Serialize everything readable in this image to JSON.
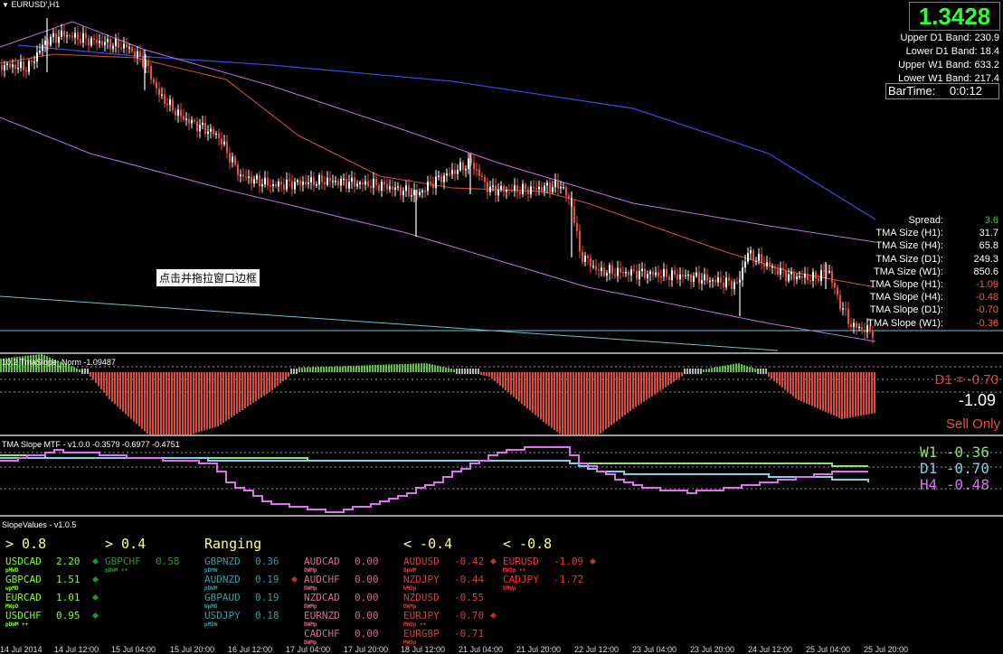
{
  "main": {
    "title": "EURUSD',H1",
    "price": "1.3428",
    "bands": [
      {
        "label": "Upper D1 Band:",
        "value": "230.9"
      },
      {
        "label": "Lower D1 Band:",
        "value": "18.4"
      },
      {
        "label": "Upper W1 Band:",
        "value": "633.2"
      },
      {
        "label": "Lower W1 Band:",
        "value": "217.4"
      }
    ],
    "bartime_label": "BarTime:",
    "bartime_value": "0:0:12",
    "info": [
      {
        "label": "Spread:",
        "value": "3.6",
        "color": "#32d232"
      },
      {
        "label": "TMA Size (H1):",
        "value": "31.7",
        "color": "#ffffff"
      },
      {
        "label": "TMA Size (H4):",
        "value": "65.8",
        "color": "#ffffff"
      },
      {
        "label": "TMA Size (D1):",
        "value": "249.3",
        "color": "#ffffff"
      },
      {
        "label": "TMA Size (W1):",
        "value": "850.6",
        "color": "#ffffff"
      },
      {
        "label": "TMA Slope (H1):",
        "value": "-1.09",
        "color": "#ff5a3c"
      },
      {
        "label": "TMA Slope (H4):",
        "value": "-0.48",
        "color": "#ff5a3c"
      },
      {
        "label": "TMA Slope (D1):",
        "value": "-0.70",
        "color": "#ff5a3c"
      },
      {
        "label": "TMA Slope (W1):",
        "value": "-0.36",
        "color": "#ff5a3c"
      }
    ],
    "tooltip": "点击并拖拉窗口边框"
  },
  "norm_panel": {
    "title": "10.2 TmaSlope_Norm -1.09487",
    "d1_text": "D1 = -0.70",
    "h1_value": "-1.09",
    "signal": "Sell Only"
  },
  "mtf_panel": {
    "title": "TMA Slope MTF - v1.0.0 -0.3579 -0.6977 -0.4751",
    "legend": [
      {
        "label": "W1 -0.36",
        "color": "#90e070"
      },
      {
        "label": "D1 -0.70",
        "color": "#80d0e8"
      },
      {
        "label": "H4 -0.48",
        "color": "#e070f0"
      }
    ]
  },
  "slope_panel": {
    "title": "SlopeValues - v1.0.5",
    "columns": [
      {
        "header": "> 0.8",
        "header_color": "#ffff80",
        "pairs": [
          {
            "name": "USDCAD",
            "value": "2.20",
            "sub": "pMWD",
            "color": "#80ff20",
            "dot": "#1a9a1a"
          },
          {
            "name": "GBPCAD",
            "value": "1.51",
            "sub": "wpMD",
            "color": "#80ff20",
            "dot": "#1a9a1a"
          },
          {
            "name": "EURCAD",
            "value": "1.01",
            "sub": "MWpD",
            "color": "#80ff20",
            "dot": "#1a9a1a"
          },
          {
            "name": "USDCHF",
            "value": "0.95",
            "sub": "pDWM ++",
            "color": "#80ff20",
            "dot": "#1a9a1a"
          }
        ]
      },
      {
        "header": "> 0.4",
        "header_color": "#ffff80",
        "pairs": [
          {
            "name": "GBPCHF",
            "value": "0.58",
            "sub": "pDWM ++",
            "color": "#2a9a2a",
            "dot": ""
          }
        ]
      },
      {
        "header": "Ranging",
        "header_color": "#ffff80",
        "pairs": [
          {
            "name": "GBPNZD",
            "value": "0.36",
            "sub": "pDMW",
            "color": "#3a9aa0",
            "dot": ""
          },
          {
            "name": "AUDNZD",
            "value": "0.19",
            "sub": "pDWM",
            "color": "#3a9aa0",
            "dot": "#c03030"
          },
          {
            "name": "GBPAUD",
            "value": "0.19",
            "sub": "WpMD",
            "color": "#3a9aa0",
            "dot": ""
          },
          {
            "name": "USDJPY",
            "value": "0.18",
            "sub": "pMDW",
            "color": "#3a9aa0",
            "dot": ""
          }
        ]
      },
      {
        "header": "",
        "header_color": "#ffff80",
        "pairs": [
          {
            "name": "AUDCAD",
            "value": "0.00",
            "sub": "DWMp",
            "color": "#d07090",
            "dot": ""
          },
          {
            "name": "AUDCHF",
            "value": "0.00",
            "sub": "DWMp",
            "color": "#d07090",
            "dot": ""
          },
          {
            "name": "NZDCAD",
            "value": "0.00",
            "sub": "DWMp",
            "color": "#d07090",
            "dot": ""
          },
          {
            "name": "EURNZD",
            "value": "0.00",
            "sub": "DWMp",
            "color": "#d07090",
            "dot": ""
          },
          {
            "name": "CADCHF",
            "value": "0.00",
            "sub": "DWMp",
            "color": "#d07090",
            "dot": ""
          }
        ]
      },
      {
        "header": "< -0.4",
        "header_color": "#ffff80",
        "pairs": [
          {
            "name": "AUDUSD",
            "value": "-0.42",
            "sub": "DpWM",
            "color": "#d04040",
            "dot": "#c03030"
          },
          {
            "name": "NZDJPY",
            "value": "-0.44",
            "sub": "WMDp",
            "color": "#d04040",
            "dot": ""
          },
          {
            "name": "NZDUSD",
            "value": "-0.55",
            "sub": "DWMp",
            "color": "#d04040",
            "dot": ""
          },
          {
            "name": "EURJPY",
            "value": "-0.70",
            "sub": "MWDp ++",
            "color": "#d04040",
            "dot": "#c03030"
          },
          {
            "name": "EURGBP",
            "value": "-0.71",
            "sub": "MWDp",
            "color": "#d04040",
            "dot": ""
          }
        ]
      },
      {
        "header": "< -0.8",
        "header_color": "#ffff80",
        "pairs": [
          {
            "name": "EURUSD",
            "value": "-1.09",
            "sub": "MWDp ++",
            "color": "#ff3030",
            "dot": "#c03030"
          },
          {
            "name": "CADJPY",
            "value": "-1.72",
            "sub": "DMWp",
            "color": "#ff3030",
            "dot": ""
          }
        ]
      }
    ]
  },
  "x_axis": [
    "14 Jul 2014",
    "14 Jul 12:00",
    "15 Jul 04:00",
    "15 Jul 20:00",
    "16 Jul 12:00",
    "17 Jul 04:00",
    "17 Jul 20:00",
    "18 Jul 12:00",
    "21 Jul 04:00",
    "21 Jul 20:00",
    "22 Jul 12:00",
    "23 Jul 04:00",
    "23 Jul 20:00",
    "24 Jul 12:00",
    "25 Jul 04:00",
    "25 Jul 20:00"
  ],
  "colors": {
    "bull_candle": "#ffffff",
    "bear_candle": "#e8503c",
    "tma_line": "#d05030",
    "band_line": "#c070e0",
    "w1_line": "#3050e0",
    "norm_bar_down": "#d94c3c",
    "norm_bar_up": "#60c040",
    "norm_bar_flat": "#b4b4b4"
  }
}
